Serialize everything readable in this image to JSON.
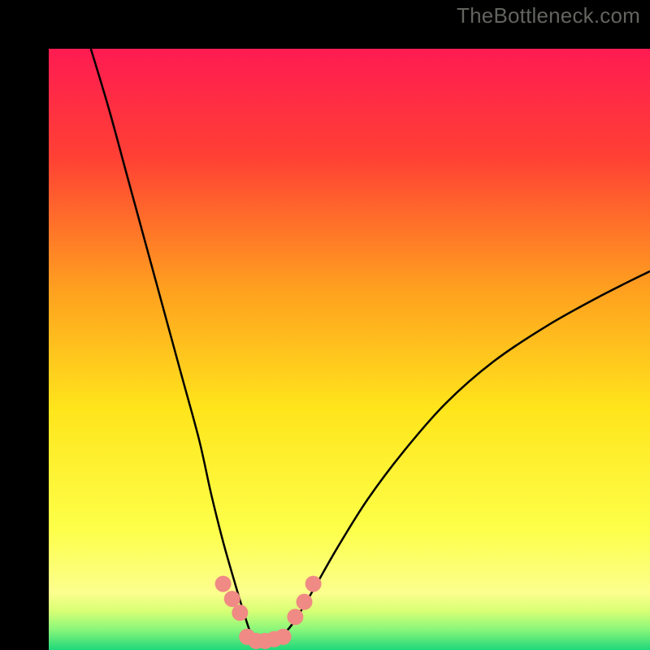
{
  "watermark": "TheBottleneck.com",
  "chart_data": {
    "type": "line",
    "title": "",
    "xlabel": "",
    "ylabel": "",
    "xlim": [
      0,
      100
    ],
    "ylim": [
      0,
      100
    ],
    "background_gradient_stops": [
      {
        "offset": 0,
        "color": "#ff1b52"
      },
      {
        "offset": 0.18,
        "color": "#ff4034"
      },
      {
        "offset": 0.4,
        "color": "#ffa01f"
      },
      {
        "offset": 0.6,
        "color": "#ffe51c"
      },
      {
        "offset": 0.8,
        "color": "#fdff49"
      },
      {
        "offset": 0.905,
        "color": "#fcff8e"
      },
      {
        "offset": 0.935,
        "color": "#d8ff74"
      },
      {
        "offset": 0.965,
        "color": "#8cf77a"
      },
      {
        "offset": 1.0,
        "color": "#1fd87b"
      }
    ],
    "series": [
      {
        "name": "bottleneck-curve",
        "color": "#000000",
        "x": [
          7,
          10,
          13,
          16,
          19,
          22,
          25,
          27,
          29,
          31,
          32.5,
          33.5,
          34.2,
          35,
          36,
          37.5,
          39,
          41,
          44,
          48,
          53,
          59,
          66,
          74,
          83,
          92,
          100
        ],
        "y": [
          100,
          90,
          79,
          68,
          57,
          46,
          35,
          26,
          18,
          11,
          6,
          3,
          1.5,
          0.8,
          0.8,
          1.2,
          2.5,
          5,
          10,
          17,
          25,
          33,
          41,
          48,
          54,
          59,
          63
        ]
      }
    ],
    "markers": {
      "name": "highlight-points",
      "color": "#f08a84",
      "radius": 10,
      "points": [
        {
          "x": 29.0,
          "y": 11.0
        },
        {
          "x": 30.5,
          "y": 8.5
        },
        {
          "x": 31.8,
          "y": 6.2
        },
        {
          "x": 33.0,
          "y": 2.2
        },
        {
          "x": 34.5,
          "y": 1.5
        },
        {
          "x": 36.0,
          "y": 1.5
        },
        {
          "x": 37.5,
          "y": 1.8
        },
        {
          "x": 39.0,
          "y": 2.2
        },
        {
          "x": 41.0,
          "y": 5.5
        },
        {
          "x": 42.5,
          "y": 8.0
        },
        {
          "x": 44.0,
          "y": 11.0
        }
      ]
    }
  }
}
